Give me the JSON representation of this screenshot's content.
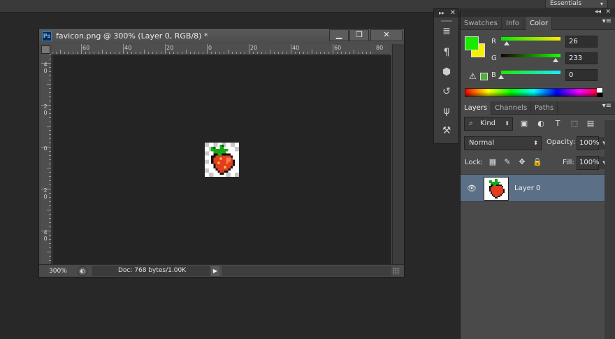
{
  "topbar": {
    "workspace": "Essentials",
    "workspace_arrow": "▾"
  },
  "document": {
    "ps_badge": "Ps",
    "title": "favicon.png @ 300% (Layer 0, RGB/8) *",
    "min_glyph": "▁",
    "max_glyph": "❐",
    "close_glyph": "✕",
    "ruler_h_labels": [
      "60",
      "40",
      "20",
      "0",
      "20",
      "40",
      "60",
      "80"
    ],
    "ruler_v_labels": [
      "4\n0",
      "2\n0",
      "0",
      "2\n0",
      "4\n0"
    ],
    "zoom": "300%",
    "doc_info": "Doc: 768 bytes/1.00K",
    "status_arrow": "▶",
    "status_icon": "◐"
  },
  "toolstrip": {
    "collapse": "▸▸",
    "close": "✕"
  },
  "panels": {
    "collapse": "◂◂",
    "close": "✕",
    "color_tabs": [
      "Swatches",
      "Info",
      "Color"
    ],
    "menu_glyph": "▾≡",
    "color": {
      "r_label": "R",
      "g_label": "G",
      "b_label": "B",
      "r_value": "26",
      "g_value": "233",
      "b_value": "0",
      "fg": "#1ae900",
      "bg": "#f6f000",
      "warning_glyph": "⚠"
    },
    "layers_tabs": [
      "Layers",
      "Channels",
      "Paths"
    ],
    "filter_kind": "Kind",
    "blend_mode": "Normal",
    "opacity_label": "Opacity:",
    "opacity_value": "100%",
    "lock_label": "Lock:",
    "fill_label": "Fill:",
    "fill_value": "100%",
    "layer_name": "Layer 0",
    "eye_glyph": "👁"
  }
}
